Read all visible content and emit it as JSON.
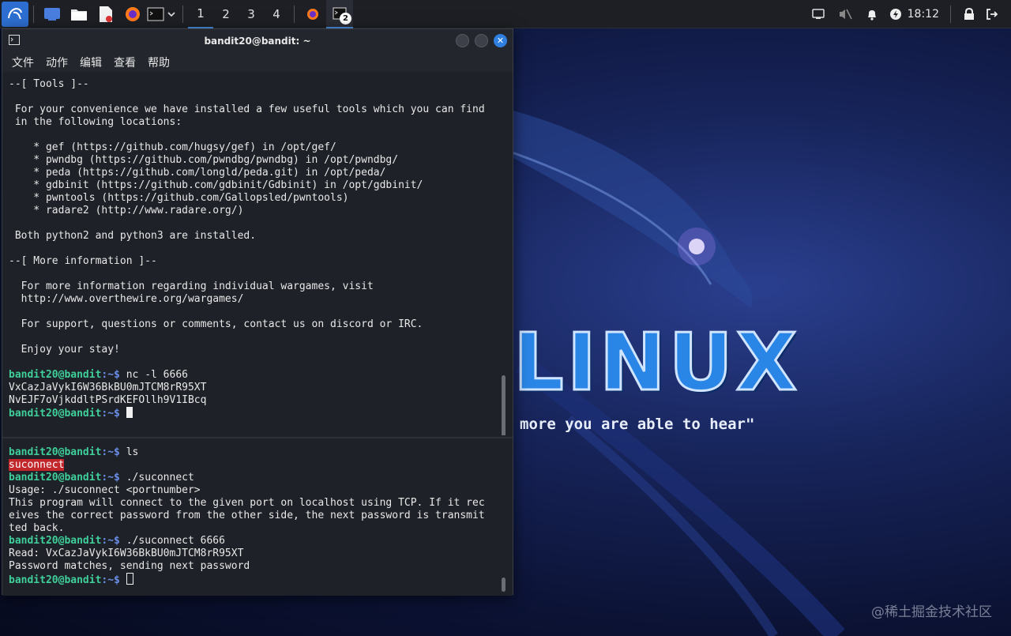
{
  "taskbar": {
    "workspaces": [
      "1",
      "2",
      "3",
      "4"
    ],
    "terminal_badge": "2",
    "clock": "18:12",
    "icons": [
      "kali-menu-icon",
      "desktop-icon",
      "files-icon",
      "text-editor-icon",
      "firefox-icon",
      "terminal-icon",
      "dropdown-icon",
      "firefox-task-icon",
      "terminal-task-icon",
      "display-icon",
      "mute-icon",
      "bell-icon",
      "power-icon",
      "lock-icon"
    ]
  },
  "window": {
    "title": "bandit20@bandit: ~",
    "menu": [
      "文件",
      "动作",
      "编辑",
      "查看",
      "帮助"
    ]
  },
  "pane1_lines": [
    {
      "pre": "",
      "text": "--[ Tools ]--"
    },
    {
      "pre": "",
      "text": ""
    },
    {
      "pre": "",
      "text": " For your convenience we have installed a few useful tools which you can find"
    },
    {
      "pre": "",
      "text": " in the following locations:"
    },
    {
      "pre": "",
      "text": ""
    },
    {
      "pre": "",
      "text": "    * gef (https://github.com/hugsy/gef) in /opt/gef/"
    },
    {
      "pre": "",
      "text": "    * pwndbg (https://github.com/pwndbg/pwndbg) in /opt/pwndbg/"
    },
    {
      "pre": "",
      "text": "    * peda (https://github.com/longld/peda.git) in /opt/peda/"
    },
    {
      "pre": "",
      "text": "    * gdbinit (https://github.com/gdbinit/Gdbinit) in /opt/gdbinit/"
    },
    {
      "pre": "",
      "text": "    * pwntools (https://github.com/Gallopsled/pwntools)"
    },
    {
      "pre": "",
      "text": "    * radare2 (http://www.radare.org/)"
    },
    {
      "pre": "",
      "text": ""
    },
    {
      "pre": "",
      "text": " Both python2 and python3 are installed."
    },
    {
      "pre": "",
      "text": ""
    },
    {
      "pre": "",
      "text": "--[ More information ]--"
    },
    {
      "pre": "",
      "text": ""
    },
    {
      "pre": "",
      "text": "  For more information regarding individual wargames, visit"
    },
    {
      "pre": "",
      "text": "  http://www.overthewire.org/wargames/"
    },
    {
      "pre": "",
      "text": ""
    },
    {
      "pre": "",
      "text": "  For support, questions or comments, contact us on discord or IRC."
    },
    {
      "pre": "",
      "text": ""
    },
    {
      "pre": "",
      "text": "  Enjoy your stay!"
    },
    {
      "pre": "",
      "text": ""
    }
  ],
  "pane1_session": {
    "prompt_user": "bandit20@bandit",
    "prompt_path": ":~$",
    "cmd1": " nc -l 6666",
    "out1": "VxCazJaVykI6W36BkBU0mJTCM8rR95XT",
    "out2": "NvEJF7oVjkddltPSrdKEFOllh9V1IBcq"
  },
  "pane2_session": {
    "prompt_user": "bandit20@bandit",
    "prompt_path": ":~$",
    "cmd_ls": " ls",
    "ls_out": "suconnect",
    "cmd_run": " ./suconnect",
    "usage": "Usage: ./suconnect <portnumber>",
    "desc1": "This program will connect to the given port on localhost using TCP. If it rec",
    "desc2": "eives the correct password from the other side, the next password is transmit",
    "desc3": "ted back.",
    "cmd_run2": " ./suconnect 6666",
    "read": "Read: VxCazJaVykI6W36BkBU0mJTCM8rR95XT",
    "match": "Password matches, sending next password"
  },
  "wallpaper": {
    "logo": "LINUX",
    "quote": "more you are able to hear\""
  },
  "watermark": "@稀土掘金技术社区"
}
